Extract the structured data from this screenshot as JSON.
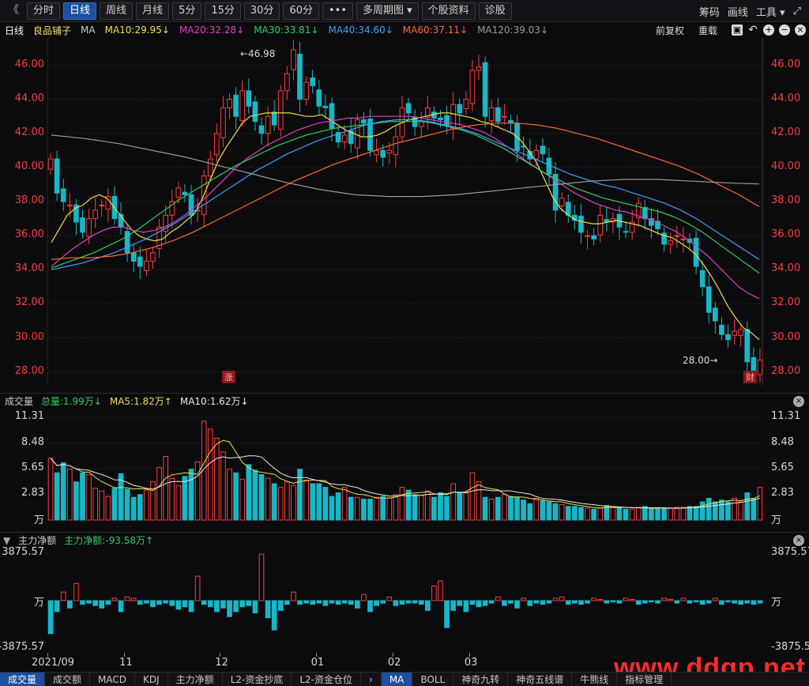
{
  "toolbar": {
    "back": "《",
    "periods": [
      "分时",
      "日线",
      "周线",
      "月线",
      "5分",
      "15分",
      "30分",
      "60分",
      "•••",
      "多周期图 ▾",
      "个股资料",
      "诊股"
    ],
    "active_index": 1,
    "right": [
      "筹码",
      "画线",
      "工具 ▾"
    ],
    "expand_icon": "⤢"
  },
  "info": {
    "period": "日线",
    "name": "良品铺子",
    "ma_label": "MA",
    "ma10": "MA10:29.95↓",
    "ma20": "MA20:32.28↓",
    "ma30": "MA30:33.81↓",
    "ma40": "MA40:34.60↓",
    "ma60": "MA60:37.11↓",
    "ma120": "MA120:39.03↓",
    "fq": "前复权",
    "reset": "重载",
    "colors": {
      "ma10": "#f0e040",
      "ma20": "#e040c0",
      "ma30": "#30d060",
      "ma40": "#3aa0ff",
      "ma60": "#ff6a30",
      "ma120": "#9a9a9a"
    }
  },
  "price_axis": [
    "46.00",
    "44.00",
    "42.00",
    "40.00",
    "38.00",
    "36.00",
    "34.00",
    "32.00",
    "30.00",
    "28.00"
  ],
  "price_marks": {
    "high": "←46.98",
    "low": "28.00→",
    "zhang": "涨",
    "cai": "财"
  },
  "volume": {
    "title": "成交量",
    "total": "总量:1.99万↓",
    "ma5": "MA5:1.82万↑",
    "ma10": "MA10:1.62万↓",
    "axis": [
      "11.31",
      "8.48",
      "5.65",
      "2.83",
      "万"
    ]
  },
  "flow": {
    "title": "主力净额",
    "value": "主力净额:-93.58万↑",
    "axis": [
      "3875.57",
      "万",
      "-3875.57"
    ]
  },
  "date_axis": [
    "2021/09",
    "11",
    "12",
    "01",
    "02",
    "03"
  ],
  "bottom_tabs": [
    "成交量",
    "成交额",
    "MACD",
    "KDJ",
    "主力净额",
    "L2-资金抄底",
    "L2-资金仓位",
    "›",
    "MA",
    "BOLL",
    "神奇九转",
    "神奇五线谱",
    "牛熊线",
    "指标管理"
  ],
  "watermark": "www.ddgp.net",
  "chart_data": {
    "type": "candlestick",
    "title": "良品铺子 日线",
    "ylim": [
      27.2,
      47.6
    ],
    "close": [
      40.5,
      38.5,
      38.0,
      37.8,
      36.8,
      36.2,
      37.0,
      37.5,
      37.8,
      38.3,
      37.0,
      36.5,
      35.0,
      34.5,
      34.2,
      34.5,
      35.0,
      36.5,
      37.2,
      38.0,
      38.8,
      38.4,
      37.2,
      37.5,
      39.5,
      40.5,
      42.0,
      43.5,
      44.0,
      43.0,
      44.5,
      43.6,
      42.7,
      42.0,
      43.0,
      42.5,
      44.5,
      45.5,
      46.9,
      44.0,
      45.0,
      44.8,
      43.6,
      43.5,
      42.3,
      41.5,
      41.9,
      41.4,
      42.8,
      42.6,
      41.0,
      41.0,
      40.6,
      41.0,
      41.8,
      43.5,
      43.2,
      42.4,
      42.7,
      43.5,
      42.9,
      42.8,
      42.5,
      43.7,
      43.2,
      44.0,
      45.7,
      45.9,
      43.0,
      43.5,
      42.7,
      43.0,
      42.6,
      41.0,
      41.2,
      40.5,
      41.0,
      40.8,
      39.6,
      37.5,
      38.2,
      37.2,
      36.9,
      36.2,
      36.0,
      35.8,
      37.2,
      36.8,
      37.0,
      36.5,
      36.2,
      36.8,
      37.9,
      37.0,
      36.6,
      36.4,
      35.5,
      35.7,
      36.0,
      35.8,
      35.6,
      34.2,
      33.0,
      31.5,
      31.0,
      30.2,
      29.9,
      30.4,
      30.5,
      28.6,
      28.1,
      28.7
    ],
    "volume_ylim": [
      0,
      11.31
    ],
    "volume": [
      6.8,
      5.2,
      6.3,
      5.6,
      4.2,
      5.2,
      5.0,
      3.5,
      3.2,
      2.6,
      3.5,
      5.1,
      3.4,
      2.5,
      2.8,
      3.3,
      4.2,
      5.8,
      7.0,
      4.6,
      3.8,
      4.8,
      5.6,
      6.4,
      10.9,
      10.0,
      9.0,
      7.5,
      5.6,
      5.2,
      4.5,
      6.1,
      5.5,
      5.0,
      4.6,
      4.0,
      3.6,
      4.2,
      3.8,
      5.6,
      4.4,
      4.0,
      4.0,
      3.6,
      2.6,
      3.0,
      3.6,
      2.5,
      2.5,
      2.3,
      2.3,
      2.5,
      2.6,
      2.4,
      2.8,
      3.6,
      3.3,
      2.8,
      2.7,
      3.2,
      2.5,
      3.0,
      2.6,
      4.0,
      3.0,
      3.0,
      5.2,
      4.2,
      2.5,
      2.3,
      2.5,
      2.8,
      2.6,
      2.5,
      2.2,
      1.8,
      2.4,
      2.1,
      2.0,
      1.8,
      1.7,
      1.5,
      1.5,
      1.4,
      1.3,
      1.2,
      1.3,
      1.6,
      1.5,
      1.4,
      1.2,
      1.2,
      1.4,
      1.5,
      1.2,
      1.2,
      1.3,
      1.3,
      1.4,
      1.4,
      1.5,
      1.5,
      2.0,
      2.4,
      2.0,
      2.2,
      2.0,
      2.4,
      2.0,
      3.0,
      2.4,
      3.6
    ],
    "flow_ylim": [
      -3875.57,
      3875.57
    ],
    "flow": [
      -2700,
      -900,
      700,
      -600,
      1400,
      -300,
      -200,
      -400,
      -600,
      -300,
      200,
      -900,
      300,
      200,
      -300,
      -200,
      -500,
      -300,
      -200,
      -400,
      -700,
      -500,
      -900,
      2000,
      -300,
      -500,
      -900,
      -600,
      -1300,
      -900,
      -500,
      -400,
      -1000,
      3800,
      -1400,
      -2400,
      -800,
      -300,
      700,
      -300,
      -200,
      -300,
      -200,
      -400,
      -200,
      -300,
      -200,
      -300,
      -600,
      500,
      -900,
      -400,
      -200,
      300,
      -400,
      -300,
      -200,
      -200,
      -300,
      -800,
      1200,
      1600,
      -2200,
      -800,
      -400,
      -900,
      -300,
      -500,
      -400,
      -200,
      300,
      -400,
      -200,
      -600,
      200,
      -400,
      -200,
      -300,
      -200,
      200,
      300,
      -300,
      -200,
      -300,
      -200,
      200,
      100,
      -200,
      -100,
      -200,
      200,
      100,
      -300,
      -200,
      -100,
      -200,
      200,
      100,
      -200,
      200,
      -200,
      -100,
      -300,
      -200,
      200,
      -300,
      -100,
      -200,
      -300,
      -200,
      -300,
      -200
    ],
    "ma_lines": [
      {
        "name": "MA10",
        "color": "#f0e040",
        "values": [
          35.6,
          36.4,
          37.2,
          37.6,
          37.8,
          38.2,
          38.4,
          38.2,
          37.6,
          37.0,
          36.4,
          36.0,
          35.8,
          35.7,
          35.8,
          36.2,
          36.5,
          36.9,
          37.3,
          38.2,
          39.3,
          40.4,
          41.2,
          41.9,
          42.6,
          43.0,
          43.1,
          43.2,
          43.2,
          43.2,
          43.2,
          43.1,
          43.0,
          43.0,
          43.1,
          42.8,
          42.5,
          42.2,
          42.0,
          41.8,
          41.8,
          41.9,
          42.1,
          42.4,
          42.6,
          42.8,
          42.9,
          43.0,
          43.1,
          43.2,
          43.2,
          43.1,
          43.0,
          42.9,
          42.7,
          42.6,
          42.4,
          42.2,
          42.0,
          41.6,
          41.0,
          40.3,
          39.3,
          38.3,
          37.6,
          37.2,
          36.9,
          36.8,
          36.7,
          36.7,
          36.8,
          36.9,
          36.8,
          36.7,
          36.6,
          36.4,
          36.2,
          36.0,
          35.9,
          35.6,
          35.3,
          34.9,
          34.3,
          33.6,
          32.8,
          31.9,
          31.2,
          30.6,
          30.3,
          29.9
        ]
      },
      {
        "name": "MA20",
        "color": "#e040c0",
        "values": [
          34.2,
          34.7,
          35.2,
          35.6,
          36.0,
          36.3,
          36.5,
          36.5,
          36.3,
          36.2,
          36.3,
          36.5,
          36.8,
          37.2,
          37.7,
          38.2,
          38.8,
          39.4,
          40.0,
          40.5,
          40.9,
          41.3,
          41.6,
          41.9,
          42.2,
          42.4,
          42.6,
          42.7,
          42.8,
          42.9,
          42.9,
          43.0,
          43.0,
          43.0,
          43.0,
          43.0,
          42.9,
          42.8,
          42.7,
          42.6,
          42.5,
          42.3,
          42.1,
          41.8,
          41.4,
          41.0,
          40.5,
          40.1,
          39.7,
          39.3,
          38.9,
          38.5,
          38.2,
          37.9,
          37.7,
          37.5,
          37.4,
          37.2,
          37.0,
          36.8,
          36.5,
          36.2,
          35.8,
          35.3,
          34.8,
          34.2,
          33.6,
          33.0,
          32.6,
          32.3
        ]
      },
      {
        "name": "MA30",
        "color": "#30d060",
        "values": [
          34.1,
          34.4,
          34.7,
          35.0,
          35.4,
          35.8,
          36.3,
          36.9,
          37.5,
          38.1,
          38.6,
          39.1,
          39.6,
          40.1,
          40.5,
          40.9,
          41.3,
          41.6,
          41.9,
          42.1,
          42.3,
          42.4,
          42.5,
          42.6,
          42.7,
          42.7,
          42.7,
          42.6,
          42.4,
          42.2,
          41.9,
          41.5,
          41.1,
          40.6,
          40.1,
          39.6,
          39.2,
          38.8,
          38.5,
          38.2,
          38.0,
          37.8,
          37.6,
          37.4,
          37.1,
          36.7,
          36.2,
          35.6,
          35.0,
          34.4,
          33.8
        ]
      },
      {
        "name": "MA40",
        "color": "#3aa0ff",
        "values": [
          34.0,
          34.2,
          34.4,
          34.7,
          35.0,
          35.4,
          35.8,
          36.3,
          36.8,
          37.4,
          38.0,
          38.6,
          39.2,
          39.8,
          40.3,
          40.8,
          41.2,
          41.6,
          41.9,
          42.2,
          42.5,
          42.7,
          42.8,
          42.8,
          42.7,
          42.5,
          42.3,
          42.0,
          41.6,
          41.2,
          40.8,
          40.4,
          40.0,
          39.6,
          39.3,
          39.0,
          38.8,
          38.5,
          38.2,
          37.9,
          37.5,
          37.0,
          36.4,
          35.8,
          35.2,
          34.6
        ]
      },
      {
        "name": "MA60",
        "color": "#ff6a30",
        "values": [
          34.6,
          34.7,
          34.7,
          34.8,
          35.0,
          35.3,
          35.7,
          36.2,
          36.8,
          37.4,
          38.0,
          38.6,
          39.2,
          39.7,
          40.2,
          40.6,
          41.0,
          41.4,
          41.7,
          42.0,
          42.3,
          42.5,
          42.6,
          42.6,
          42.5,
          42.3,
          42.0,
          41.7,
          41.3,
          40.9,
          40.5,
          40.1,
          39.6,
          39.0,
          38.4,
          37.7
        ]
      },
      {
        "name": "MA120",
        "color": "#9a9a9a",
        "values": [
          41.9,
          41.7,
          41.4,
          41.0,
          40.6,
          40.1,
          39.6,
          39.1,
          38.7,
          38.4,
          38.3,
          38.3,
          38.4,
          38.6,
          38.8,
          39.0,
          39.2,
          39.3,
          39.3,
          39.2,
          39.1,
          39.03
        ]
      }
    ]
  }
}
